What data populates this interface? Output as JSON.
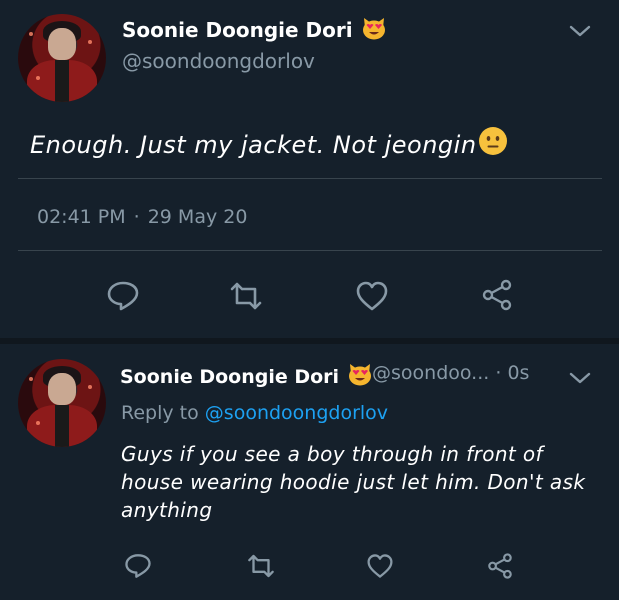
{
  "tweet1": {
    "author_name": "Soonie Doongie Dori",
    "author_emoji": "heart-eyes-cat-emoji",
    "handle": "@soondoongdorlov",
    "text": "Enough. Just my jacket. Not jeongin",
    "text_emoji": "neutral-face-emoji",
    "time": "02:41 PM",
    "separator": "·",
    "date": "29 May 20"
  },
  "tweet2": {
    "author_name": "Soonie Doongie Dori",
    "author_emoji": "heart-eyes-cat-emoji",
    "handle": "@soondoo...",
    "separator": "·",
    "age": "0s",
    "reply_prefix": "Reply to",
    "reply_handle": "@soondoongdorlov",
    "text": "Guys if you see a boy through in front of house wearing hoodie just let him. Don't ask anything"
  },
  "actions": [
    "reply-icon",
    "retweet-icon",
    "like-icon",
    "share-icon"
  ],
  "colors": {
    "background": "#15202b",
    "primary_text": "#ffffff",
    "secondary_text": "#8899a6",
    "link": "#1da1f2",
    "divider": "#38444d"
  }
}
